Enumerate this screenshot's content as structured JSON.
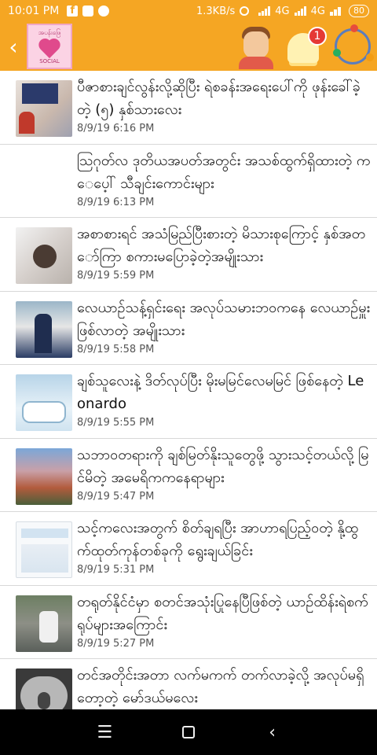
{
  "status_bar": {
    "time": "10:01 PM",
    "speed": "1.3KB/s",
    "network_1": "4G",
    "network_2": "4G",
    "battery": "80"
  },
  "app_bar": {
    "back_icon": "chevron-left-icon",
    "logo_text": "အပန်းဖြေ",
    "logo_sub": "SOCIAL",
    "notification_count": "1"
  },
  "feed": {
    "items": [
      {
        "title": "ပီဇာစားချင်လွန်းလို့ဆိုပြီး ရဲစခန်းအရေးပေါ်ကို ဖုန်းခေါ်ခဲ့တဲ့ (၅) နှစ်သားလေး",
        "date": "8/9/19 6:16 PM"
      },
      {
        "title": "ဩဂုတ်လ ဒုတိယအပတ်အတွင်း အသစ်ထွက်ရှိထားတဲ့ ကေပေ့ါ် သီချင်းကောင်းများ",
        "date": "8/9/19 6:13 PM"
      },
      {
        "title": "အစာစားရင် အသံမြည်ပြီးစားတဲ့ မိသားစုကြောင့် နှစ်အတော်ကြာ စကားမပြောခဲ့တဲ့အမျိုးသား",
        "date": "8/9/19 5:59 PM"
      },
      {
        "title": "လေယာဉ်သန့်ရှင်းရေး အလုပ်သမားဘဝကနေ လေယာဉ်မှူးဖြစ်လာတဲ့ အမျိုးသား",
        "date": "8/9/19 5:58 PM"
      },
      {
        "title": "ချစ်သူလေးနဲ့ ဒိတ်လုပ်ပြီး မိုးမမြင်လေမမြင် ဖြစ်နေတဲ့ Leonardo",
        "date": "8/9/19 5:55 PM"
      },
      {
        "title": "သဘာဝတရားကို ချစ်မြတ်နိုးသူတွေဖို့ သွားသင့်တယ်လို့ မြင်မိတဲ့ အမေရိကကနေရာများ",
        "date": "8/9/19 5:47 PM"
      },
      {
        "title": "သင့်ကလေးအတွက် စိတ်ချရပြီး အာဟာရပြည့်ဝတဲ့ နို့ထွက်ထုတ်ကုန်တစ်ခုကို ရွေးချယ်ခြင်း",
        "date": "8/9/19 5:31 PM"
      },
      {
        "title": "တရုတ်နိုင်ငံမှာ စတင်အသုံးပြုနေပြီဖြစ်တဲ့ ယာဉ်ထိန်းရဲစက်ရုပ်များအကြောင်း",
        "date": "8/9/19 5:27 PM"
      },
      {
        "title": "တင်အတိုင်းအတာ လက်မကက် တက်လာခဲ့လို့ အလုပ်မရှိတော့တဲ့ မော်ဒယ်မလေး",
        "date": ""
      }
    ]
  },
  "colors": {
    "accent": "#f5a623",
    "badge": "#e53935"
  }
}
